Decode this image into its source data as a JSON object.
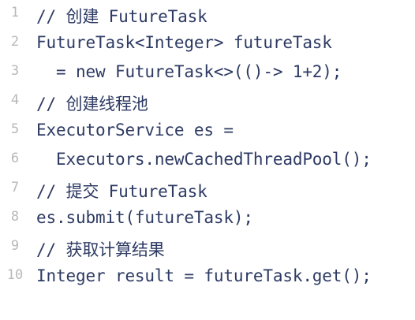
{
  "code": {
    "lines": [
      {
        "number": "1",
        "text": "// 创建 FutureTask"
      },
      {
        "number": "2",
        "text": "FutureTask<Integer> futureTask"
      },
      {
        "number": "3",
        "text": "  = new FutureTask<>(()-> 1+2);"
      },
      {
        "number": "4",
        "text": "// 创建线程池"
      },
      {
        "number": "5",
        "text": "ExecutorService es ="
      },
      {
        "number": "6",
        "text": "  Executors.newCachedThreadPool();"
      },
      {
        "number": "7",
        "text": "// 提交 FutureTask"
      },
      {
        "number": "8",
        "text": "es.submit(futureTask);"
      },
      {
        "number": "9",
        "text": "// 获取计算结果"
      },
      {
        "number": "10",
        "text": "Integer result = futureTask.get();"
      }
    ]
  },
  "colors": {
    "code_text": "#2d3a63",
    "line_number": "#b8b8b8",
    "background": "#ffffff"
  }
}
